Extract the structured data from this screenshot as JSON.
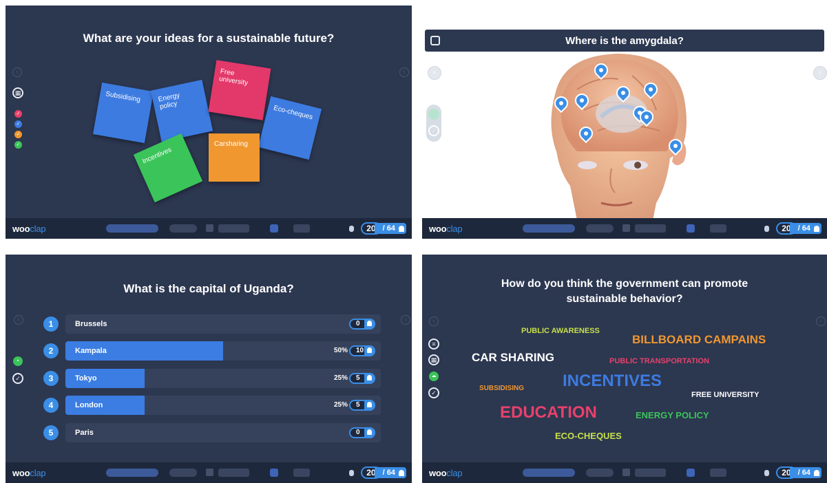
{
  "brand": {
    "logo_main": "woo",
    "logo_accent": "clap"
  },
  "footer": {
    "current": "20",
    "total": "/ 64"
  },
  "panel1": {
    "question": "What are your ideas for a sustainable future?",
    "notes": [
      {
        "text": "Subsidising",
        "color": "#3d7be0"
      },
      {
        "text": "Energy policy",
        "color": "#3d7be0"
      },
      {
        "text": "Free university",
        "color": "#e3386a"
      },
      {
        "text": "Eco-cheques",
        "color": "#3d7be0"
      },
      {
        "text": "Incentives",
        "color": "#3bc45a"
      },
      {
        "text": "Carsharing",
        "color": "#f0972f"
      }
    ],
    "dot_colors": [
      "#e8416b",
      "#3d7be0",
      "#f0972f",
      "#3bc45a"
    ]
  },
  "panel2": {
    "question": "Where is the amygdala?",
    "pin_count": 9
  },
  "panel3": {
    "question": "What is the capital of Uganda?",
    "options": [
      {
        "num": "1",
        "label": "Brussels",
        "pct": "",
        "count": "0",
        "share": 0
      },
      {
        "num": "2",
        "label": "Kampala",
        "pct": "50%",
        "count": "10",
        "share": 0.5
      },
      {
        "num": "3",
        "label": "Tokyo",
        "pct": "25%",
        "count": "5",
        "share": 0.25
      },
      {
        "num": "4",
        "label": "London",
        "pct": "25%",
        "count": "5",
        "share": 0.25
      },
      {
        "num": "5",
        "label": "Paris",
        "pct": "",
        "count": "0",
        "share": 0
      }
    ]
  },
  "panel4": {
    "question_line1": "How do you think the government can promote",
    "question_line2": "sustainable behavior?",
    "words": [
      {
        "text": "PUBLIC AWARENESS",
        "color": "#c6e04a"
      },
      {
        "text": "BILLBOARD CAMPAINS",
        "color": "#f0972f"
      },
      {
        "text": "CAR SHARING",
        "color": "#ffffff"
      },
      {
        "text": "PUBLIC TRANSPORTATION",
        "color": "#e8416b"
      },
      {
        "text": "SUBSIDISING",
        "color": "#f0972f"
      },
      {
        "text": "INCENTIVES",
        "color": "#3d7be0"
      },
      {
        "text": "FREE UNIVERSITY",
        "color": "#ffffff"
      },
      {
        "text": "EDUCATION",
        "color": "#e8416b"
      },
      {
        "text": "ENERGY POLICY",
        "color": "#3bc45a"
      },
      {
        "text": "ECO-CHEQUES",
        "color": "#c6e04a"
      }
    ]
  }
}
